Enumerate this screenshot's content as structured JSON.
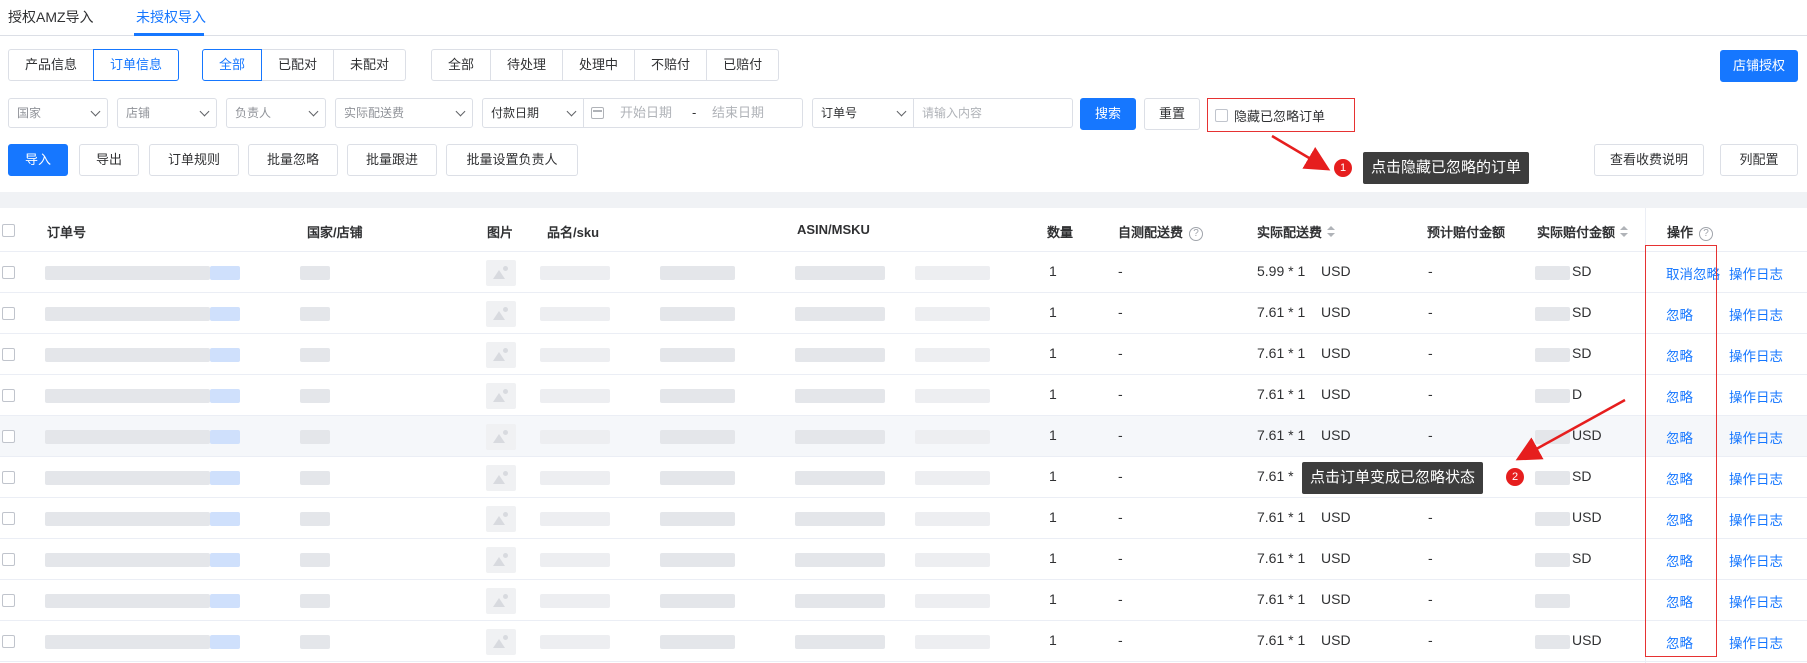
{
  "top_tabs": [
    {
      "label": "授权AMZ导入",
      "active": false
    },
    {
      "label": "未授权导入",
      "active": true
    }
  ],
  "info_tabs": [
    {
      "label": "产品信息",
      "active": false
    },
    {
      "label": "订单信息",
      "active": true
    }
  ],
  "match_filter": [
    {
      "label": "全部",
      "active": true
    },
    {
      "label": "已配对",
      "active": false
    },
    {
      "label": "未配对",
      "active": false
    }
  ],
  "status_filter": [
    {
      "label": "全部",
      "active": false
    },
    {
      "label": "待处理",
      "active": false
    },
    {
      "label": "处理中",
      "active": false
    },
    {
      "label": "不赔付",
      "active": false
    },
    {
      "label": "已赔付",
      "active": false
    }
  ],
  "store_auth_label": "店铺授权",
  "filters": {
    "country": "国家",
    "store": "店铺",
    "owner": "负责人",
    "shipping_fee": "实际配送费",
    "date_type": "付款日期",
    "start_date": "开始日期",
    "date_sep": "-",
    "end_date": "结束日期",
    "search_field": "订单号",
    "search_placeholder": "请输入内容",
    "search_label": "搜索",
    "reset_label": "重置",
    "hide_ignored_label": "隐藏已忽略订单"
  },
  "actions": {
    "import": "导入",
    "export": "导出",
    "order_rules": "订单规则",
    "batch_ignore": "批量忽略",
    "batch_follow": "批量跟进",
    "batch_owner": "批量设置负责人",
    "fee_info": "查看收费说明",
    "columns": "列配置"
  },
  "callouts": {
    "c1_num": "1",
    "c1_text": "点击隐藏已忽略的订单",
    "c2_num": "2",
    "c2_text": "点击订单变成已忽略状态"
  },
  "table": {
    "headers": {
      "order_no": "订单号",
      "country_store": "国家/店铺",
      "image": "图片",
      "name_sku": "品名/sku",
      "asin_msku": "ASIN/MSKU",
      "qty": "数量",
      "self_fee": "自测配送费",
      "actual_fee": "实际配送费",
      "est_comp": "预计赔付金额",
      "actual_comp": "实际赔付金额",
      "ops": "操作"
    },
    "rows": [
      {
        "qty": "1",
        "self_fee": "-",
        "actual_fee": "5.99 * 1",
        "fee_currency": "USD",
        "est_comp": "-",
        "comp_text": "SD",
        "op1": "取消忽略",
        "op2": "操作日志"
      },
      {
        "qty": "1",
        "self_fee": "-",
        "actual_fee": "7.61 * 1",
        "fee_currency": "USD",
        "est_comp": "-",
        "comp_text": "SD",
        "op1": "忽略",
        "op2": "操作日志"
      },
      {
        "qty": "1",
        "self_fee": "-",
        "actual_fee": "7.61 * 1",
        "fee_currency": "USD",
        "est_comp": "-",
        "comp_text": "SD",
        "op1": "忽略",
        "op2": "操作日志"
      },
      {
        "qty": "1",
        "self_fee": "-",
        "actual_fee": "7.61 * 1",
        "fee_currency": "USD",
        "est_comp": "-",
        "comp_text": "D",
        "op1": "忽略",
        "op2": "操作日志"
      },
      {
        "qty": "1",
        "self_fee": "-",
        "actual_fee": "7.61 * 1",
        "fee_currency": "USD",
        "est_comp": "-",
        "comp_text": "USD",
        "op1": "忽略",
        "op2": "操作日志"
      },
      {
        "qty": "1",
        "self_fee": "-",
        "actual_fee": "7.61 *",
        "fee_currency": "",
        "est_comp": "",
        "comp_text": "SD",
        "op1": "忽略",
        "op2": "操作日志"
      },
      {
        "qty": "1",
        "self_fee": "-",
        "actual_fee": "7.61 * 1",
        "fee_currency": "USD",
        "est_comp": "-",
        "comp_text": "USD",
        "op1": "忽略",
        "op2": "操作日志"
      },
      {
        "qty": "1",
        "self_fee": "-",
        "actual_fee": "7.61 * 1",
        "fee_currency": "USD",
        "est_comp": "-",
        "comp_text": "SD",
        "op1": "忽略",
        "op2": "操作日志"
      },
      {
        "qty": "1",
        "self_fee": "-",
        "actual_fee": "7.61 * 1",
        "fee_currency": "USD",
        "est_comp": "-",
        "comp_text": "",
        "op1": "忽略",
        "op2": "操作日志"
      },
      {
        "qty": "1",
        "self_fee": "-",
        "actual_fee": "7.61 * 1",
        "fee_currency": "USD",
        "est_comp": "-",
        "comp_text": "USD",
        "op1": "忽略",
        "op2": "操作日志"
      }
    ]
  },
  "colors": {
    "primary": "#1677ff",
    "annotation_red": "#e63232",
    "callout_bg": "#3d3d3d"
  }
}
